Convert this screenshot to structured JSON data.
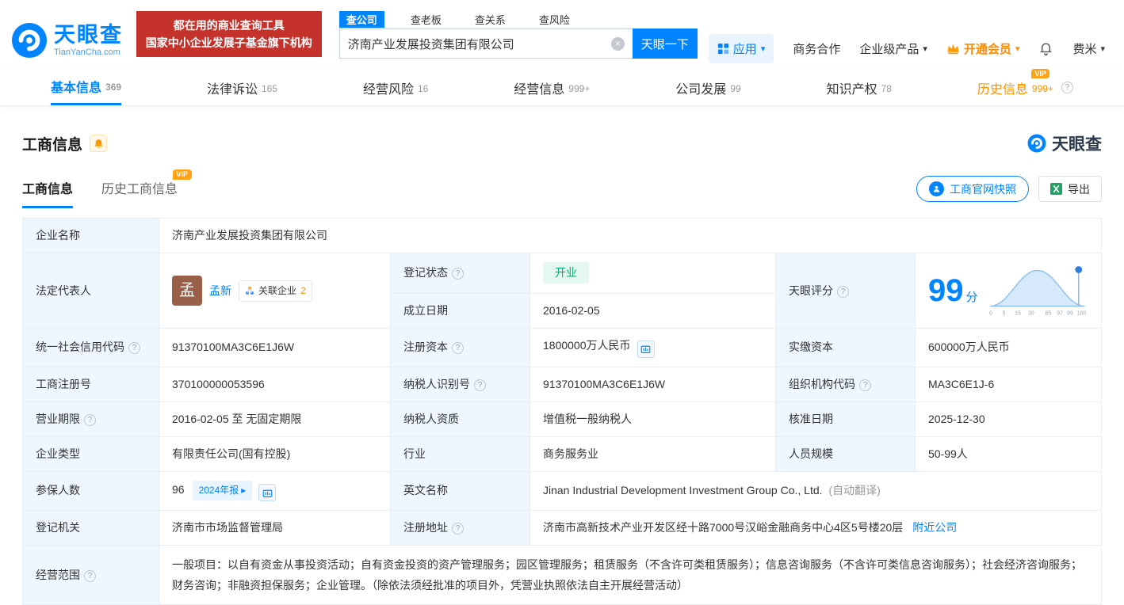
{
  "colors": {
    "primary": "#0084ff",
    "vip_orange": "#ff8a00",
    "banner_red": "#c5322b",
    "status_green": "#00a972"
  },
  "brand": {
    "name": "天眼查",
    "domain": "TianYanCha.com"
  },
  "banner": {
    "line1": "都在用的商业查询工具",
    "line2": "国家中小企业发展子基金旗下机构"
  },
  "search": {
    "tabs": [
      {
        "label": "查公司"
      },
      {
        "label": "查老板"
      },
      {
        "label": "查关系"
      },
      {
        "label": "查风险"
      }
    ],
    "value": "济南产业发展投资集团有限公司",
    "button": "天眼一下"
  },
  "topmenu": {
    "apps": "应用",
    "cooperation": "商务合作",
    "enterprise": "企业级产品",
    "vip": "开通会员",
    "user": "费米"
  },
  "nav": {
    "tabs": [
      {
        "label": "基本信息",
        "count": "369"
      },
      {
        "label": "法律诉讼",
        "count": "165"
      },
      {
        "label": "经营风险",
        "count": "16"
      },
      {
        "label": "经营信息",
        "count": "999+"
      },
      {
        "label": "公司发展",
        "count": "99"
      },
      {
        "label": "知识产权",
        "count": "78"
      },
      {
        "label": "历史信息",
        "count": "999+"
      }
    ]
  },
  "section": {
    "title": "工商信息",
    "brand": "天眼查",
    "tabs": [
      {
        "label": "工商信息"
      },
      {
        "label": "历史工商信息"
      }
    ],
    "vip_badge": "VIP",
    "snapshot_button": "工商官网快照",
    "export_button": "导出"
  },
  "info": {
    "company_name": {
      "label": "企业名称",
      "value": "济南产业发展投资集团有限公司"
    },
    "legal_rep": {
      "label": "法定代表人",
      "avatar": "孟",
      "name": "孟新",
      "related_label": "关联企业",
      "related_count": "2"
    },
    "reg_status": {
      "label": "登记状态",
      "value": "开业"
    },
    "establish_date": {
      "label": "成立日期",
      "value": "2016-02-05"
    },
    "score": {
      "label": "天眼评分",
      "value": "99",
      "unit": "分",
      "ticks": [
        "0",
        "5",
        "15",
        "30",
        "85",
        "97",
        "99",
        "100"
      ]
    },
    "credit_code": {
      "label": "统一社会信用代码",
      "value": "91370100MA3C6E1J6W"
    },
    "reg_capital": {
      "label": "注册资本",
      "value": "1800000万人民币"
    },
    "paid_capital": {
      "label": "实缴资本",
      "value": "600000万人民币"
    },
    "reg_number": {
      "label": "工商注册号",
      "value": "370100000053596"
    },
    "taxpayer_id": {
      "label": "纳税人识别号",
      "value": "91370100MA3C6E1J6W"
    },
    "org_code": {
      "label": "组织机构代码",
      "value": "MA3C6E1J-6"
    },
    "business_term": {
      "label": "营业期限",
      "value": "2016-02-05 至 无固定期限"
    },
    "taxpayer_quality": {
      "label": "纳税人资质",
      "value": "增值税一般纳税人"
    },
    "approval_date": {
      "label": "核准日期",
      "value": "2025-12-30"
    },
    "company_type": {
      "label": "企业类型",
      "value": "有限责任公司(国有控股)"
    },
    "industry": {
      "label": "行业",
      "value": "商务服务业"
    },
    "staff_size": {
      "label": "人员规模",
      "value": "50-99人"
    },
    "insured_count": {
      "label": "参保人数",
      "value": "96",
      "report_badge": "2024年报"
    },
    "english_name": {
      "label": "英文名称",
      "value": "Jinan Industrial Development Investment Group Co., Ltd.",
      "note": "(自动翻译)"
    },
    "reg_authority": {
      "label": "登记机关",
      "value": "济南市市场监督管理局"
    },
    "address": {
      "label": "注册地址",
      "value": "济南市高新技术产业开发区经十路7000号汉峪金融商务中心4区5号楼20层",
      "nearby_link": "附近公司"
    },
    "business_scope": {
      "label": "经营范围",
      "value": "一般项目：以自有资金从事投资活动；自有资金投资的资产管理服务；园区管理服务；租赁服务（不含许可类租赁服务）；信息咨询服务（不含许可类信息咨询服务）；社会经济咨询服务；财务咨询；非融资担保服务；企业管理。（除依法须经批准的项目外，凭营业执照依法自主开展经营活动）"
    }
  }
}
